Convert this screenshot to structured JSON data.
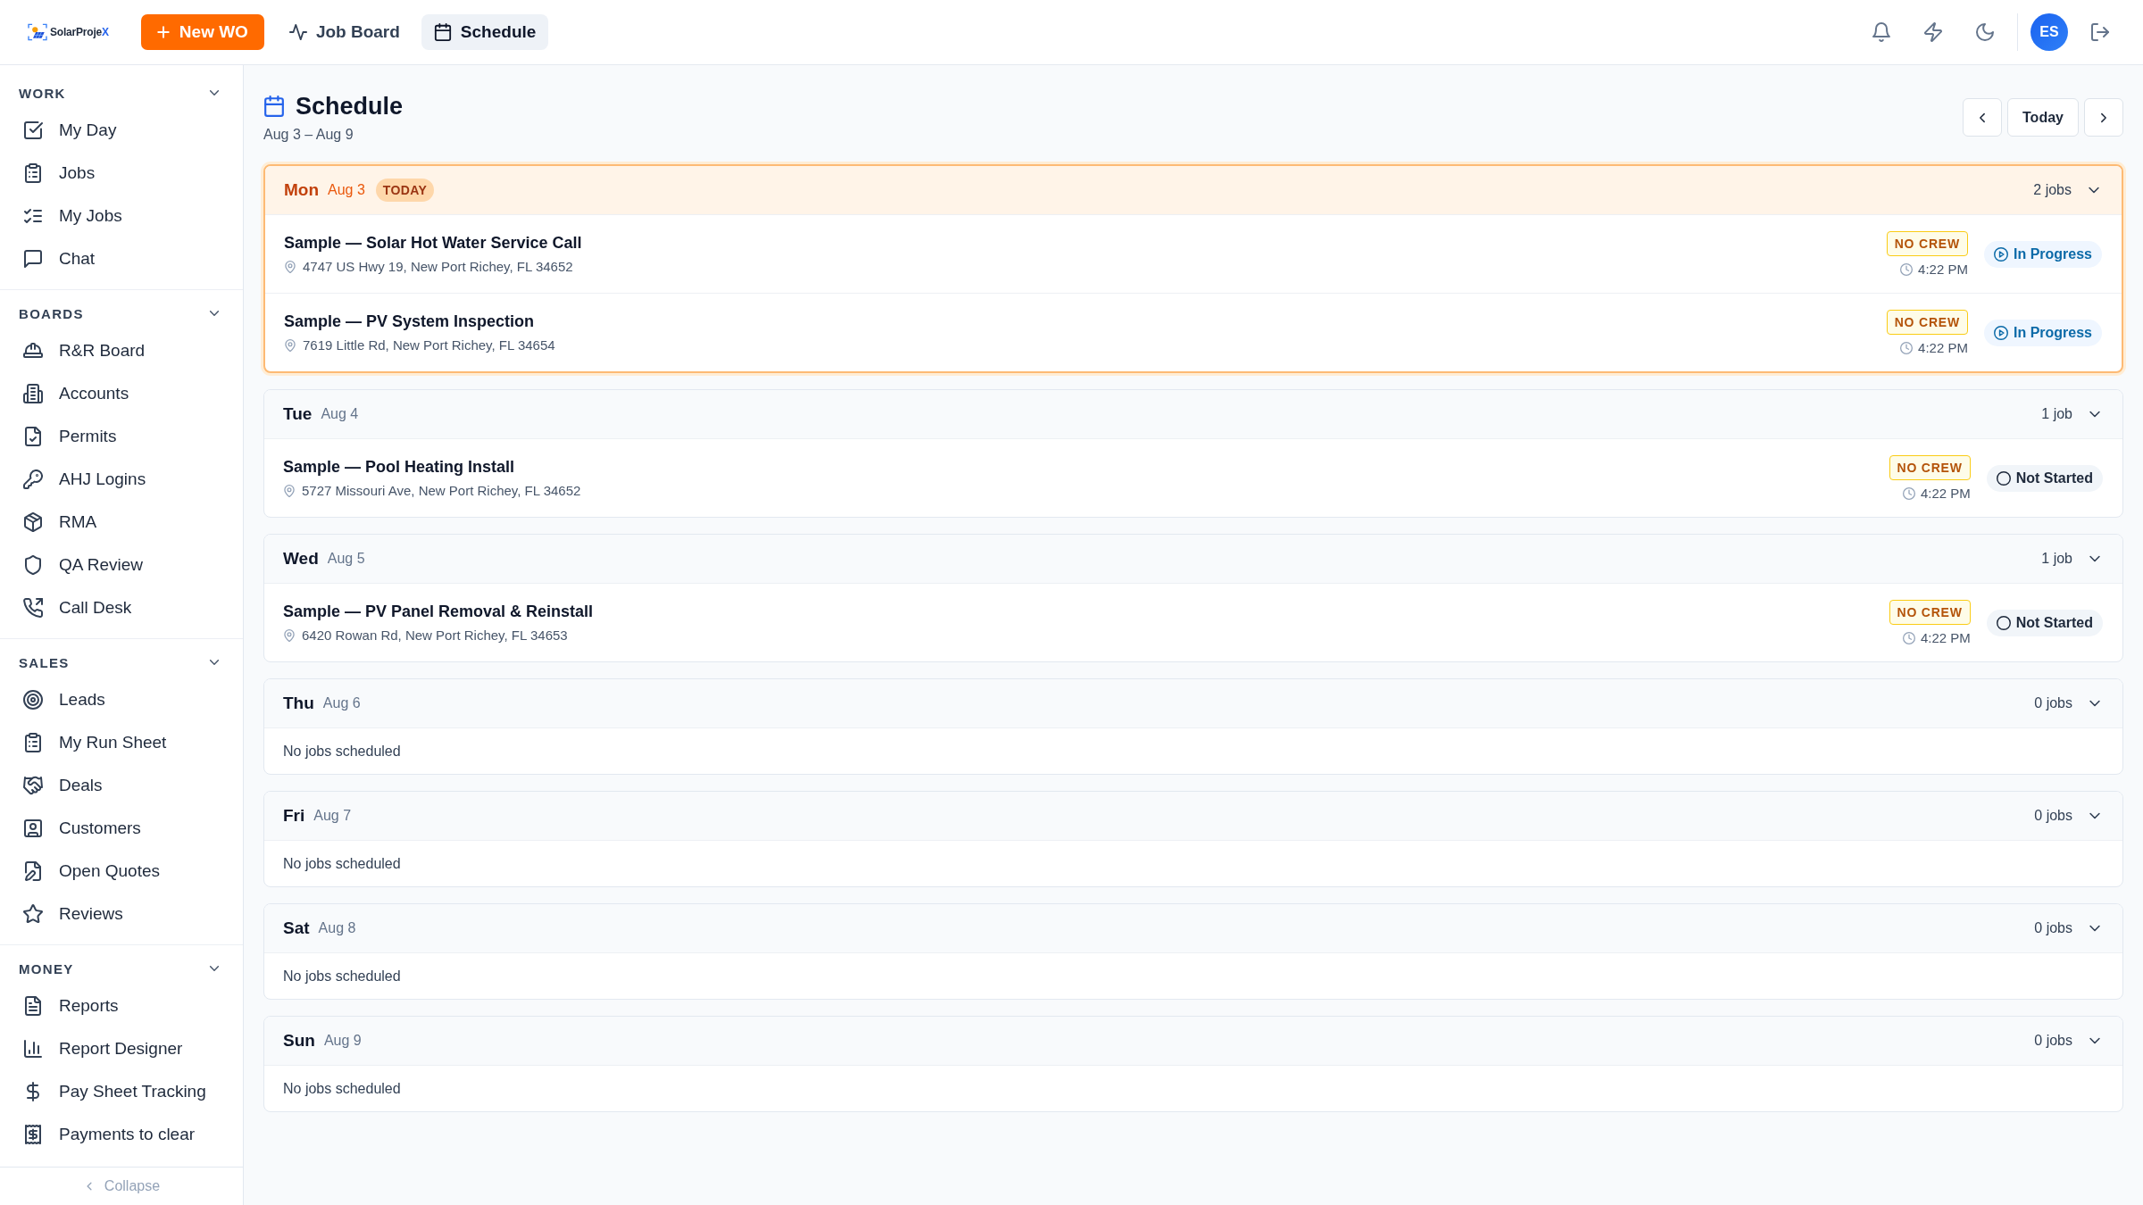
{
  "topbar": {
    "logo": {
      "name": "SolarProje",
      "accent": "X"
    },
    "new_button": {
      "label": "New WO"
    },
    "tabs": [
      {
        "label": "Job Board",
        "selected": false
      },
      {
        "label": "Schedule",
        "selected": true
      }
    ],
    "avatar": {
      "initials": "ES"
    }
  },
  "sidebar": {
    "sections": [
      {
        "title": "WORK",
        "expanded": true,
        "items": [
          {
            "label": "My Day",
            "selected": false
          },
          {
            "label": "Jobs",
            "selected": false
          },
          {
            "label": "My Jobs",
            "selected": false
          },
          {
            "label": "Chat",
            "selected": false
          }
        ]
      },
      {
        "title": "BOARDS",
        "expanded": true,
        "items": [
          {
            "label": "R&R Board",
            "selected": false
          },
          {
            "label": "Accounts",
            "selected": false
          },
          {
            "label": "Permits",
            "selected": false
          },
          {
            "label": "AHJ Logins",
            "selected": false
          },
          {
            "label": "RMA",
            "selected": false
          },
          {
            "label": "QA Review",
            "selected": false
          },
          {
            "label": "Call Desk",
            "selected": false
          }
        ]
      },
      {
        "title": "SALES",
        "expanded": true,
        "items": [
          {
            "label": "Leads",
            "selected": false
          },
          {
            "label": "My Run Sheet",
            "selected": false
          },
          {
            "label": "Deals",
            "selected": false
          },
          {
            "label": "Customers",
            "selected": false
          },
          {
            "label": "Open Quotes",
            "selected": false
          },
          {
            "label": "Reviews",
            "selected": false
          }
        ]
      },
      {
        "title": "MONEY",
        "expanded": true,
        "items": [
          {
            "label": "Reports",
            "selected": false
          },
          {
            "label": "Report Designer",
            "selected": false
          },
          {
            "label": "Pay Sheet Tracking",
            "selected": false
          },
          {
            "label": "Payments to clear",
            "selected": false
          }
        ]
      }
    ],
    "collapse": {
      "label": "Collapse"
    }
  },
  "page": {
    "title": "Schedule",
    "range": "Aug 3 – Aug 9",
    "today_button": "Today"
  },
  "days": [
    {
      "day": "Mon",
      "date": "Aug 3",
      "today": true,
      "badge": "TODAY",
      "count": "2 jobs",
      "expanded": true,
      "jobs": [
        {
          "title": "Sample — Solar Hot Water Service Call",
          "address": "4747 US Hwy 19, New Port Richey, FL 34652",
          "crew": "NO CREW",
          "time": "4:22 PM",
          "status": {
            "kind": "in_progress",
            "label": "In Progress"
          }
        },
        {
          "title": "Sample — PV System Inspection",
          "address": "7619 Little Rd, New Port Richey, FL 34654",
          "crew": "NO CREW",
          "time": "4:22 PM",
          "status": {
            "kind": "in_progress",
            "label": "In Progress"
          }
        }
      ]
    },
    {
      "day": "Tue",
      "date": "Aug 4",
      "today": false,
      "count": "1 job",
      "expanded": true,
      "jobs": [
        {
          "title": "Sample — Pool Heating Install",
          "address": "5727 Missouri Ave, New Port Richey, FL 34652",
          "crew": "NO CREW",
          "time": "4:22 PM",
          "status": {
            "kind": "not_started",
            "label": "Not Started"
          }
        }
      ]
    },
    {
      "day": "Wed",
      "date": "Aug 5",
      "today": false,
      "count": "1 job",
      "expanded": true,
      "jobs": [
        {
          "title": "Sample — PV Panel Removal & Reinstall",
          "address": "6420 Rowan Rd, New Port Richey, FL 34653",
          "crew": "NO CREW",
          "time": "4:22 PM",
          "status": {
            "kind": "not_started",
            "label": "Not Started"
          }
        }
      ]
    },
    {
      "day": "Thu",
      "date": "Aug 6",
      "today": false,
      "count": "0 jobs",
      "expanded": true,
      "empty": "No jobs scheduled"
    },
    {
      "day": "Fri",
      "date": "Aug 7",
      "today": false,
      "count": "0 jobs",
      "expanded": true,
      "empty": "No jobs scheduled"
    },
    {
      "day": "Sat",
      "date": "Aug 8",
      "today": false,
      "count": "0 jobs",
      "expanded": true,
      "empty": "No jobs scheduled"
    },
    {
      "day": "Sun",
      "date": "Aug 9",
      "today": false,
      "count": "0 jobs",
      "expanded": true,
      "empty": "No jobs scheduled"
    }
  ]
}
